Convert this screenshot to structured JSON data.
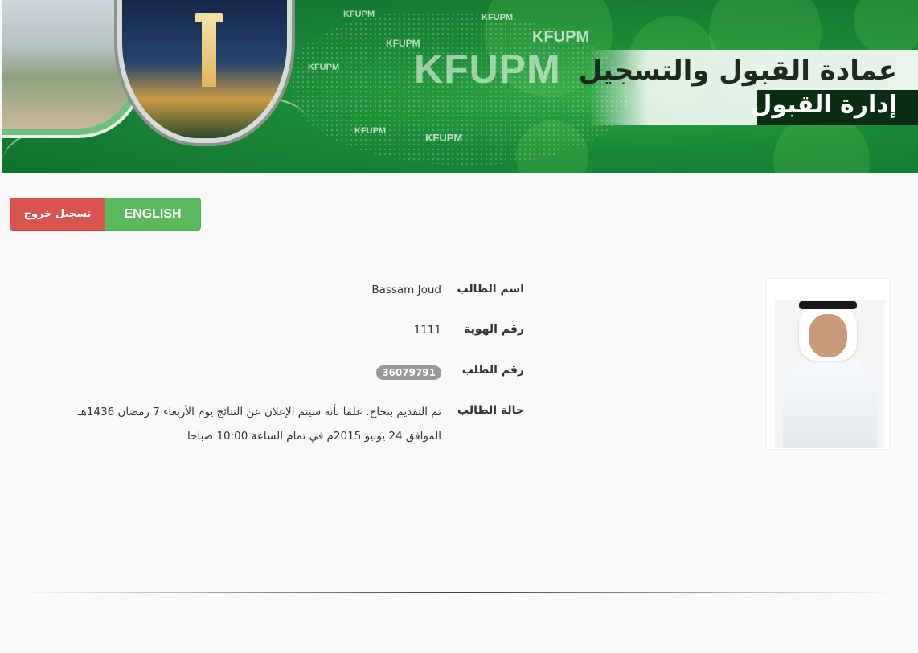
{
  "banner": {
    "title": "عمادة القبول والتسجيل",
    "subtitle": "إدارة القبول",
    "logo_text_large": "KFUPM",
    "logo_text_small": "KFUPM",
    "brand_color": "#1a8a36"
  },
  "actions": {
    "logout_label": "تسجيل خروج",
    "english_label": "ENGLISH"
  },
  "student": {
    "name_label": "اسم الطالب",
    "name_value": "Bassam Joud",
    "id_label": "رقم الهوية",
    "id_value": "1111",
    "application_label": "رقم الطلب",
    "application_value": "36079791",
    "status_label": "حالة الطالب",
    "status_line1": "تم التقديم بنجاح. علما بأنه سيتم الإعلان عن النتائج يوم الأربعاء 7 رمضان 1436هـ",
    "status_line2": "الموافق 24 يونيو 2015م في تمام الساعة 10:00 صباحا"
  }
}
